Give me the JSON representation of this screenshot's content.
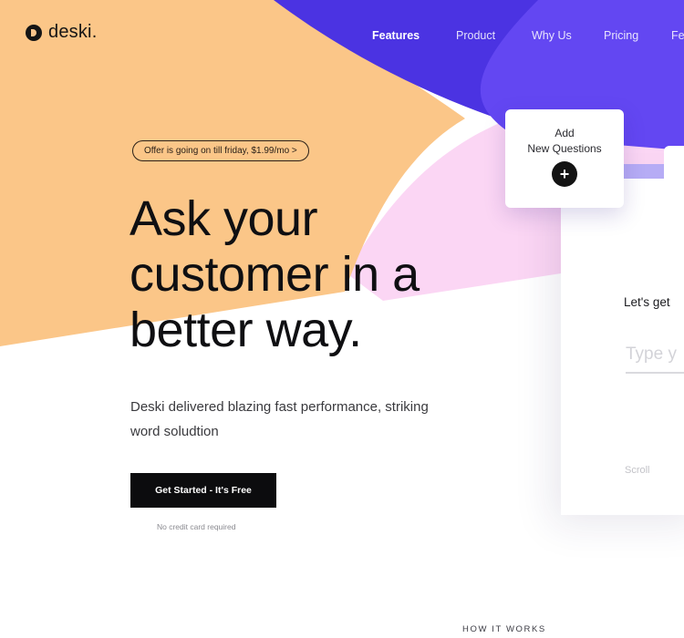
{
  "brand": {
    "name": "deski."
  },
  "nav": {
    "items": [
      "Features",
      "Product",
      "Why Us",
      "Pricing",
      "Fe"
    ]
  },
  "hero": {
    "offer": "Offer is going on till friday, $1.99/mo >",
    "title_lines": [
      "Ask your",
      "customer in a",
      "better way."
    ],
    "description_lines": [
      "Deski delivered blazing fast performance, striking",
      "word soludtion"
    ],
    "cta_label": "Get Started - It's Free",
    "cta_note": "No credit card required"
  },
  "add_card": {
    "line1": "Add",
    "line2": "New Questions",
    "plus": "+"
  },
  "form_preview": {
    "heading": "Let's get",
    "input_placeholder": "Type y",
    "scroll_label": "Scroll"
  },
  "section_label": "HOW IT WORKS",
  "colors": {
    "peach": "#fbc688",
    "purple": "#5d45ee",
    "purple_dark": "#4b33e2",
    "pink": "#fbd6f4",
    "text": "#0f0f12"
  }
}
